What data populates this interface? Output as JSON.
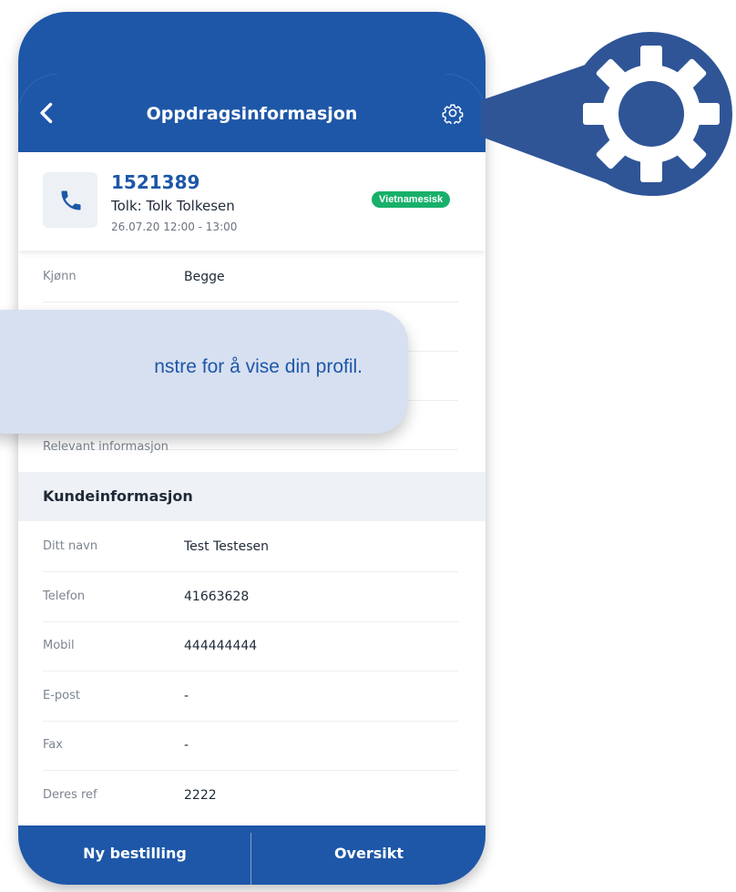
{
  "header": {
    "title": "Oppdragsinformasjon"
  },
  "job": {
    "number": "1521389",
    "interpreter": "Tolk: Tolk Tolkesen",
    "time": "26.07.20 12:00 - 13:00",
    "language": "Vietnamesisk"
  },
  "rows": [
    {
      "label": "Kjønn",
      "value": "Begge"
    },
    {
      "label": "",
      "value": ""
    },
    {
      "label": "",
      "value": ""
    },
    {
      "label": "",
      "value": ""
    },
    {
      "label": "Relevant informasjon",
      "value": ""
    }
  ],
  "customer_section": {
    "title": "Kundeinformasjon"
  },
  "customer_rows": [
    {
      "label": "Ditt navn",
      "value": "Test Testesen"
    },
    {
      "label": "Telefon",
      "value": "41663628"
    },
    {
      "label": "Mobil",
      "value": "444444444"
    },
    {
      "label": "E-post",
      "value": "-"
    },
    {
      "label": "Fax",
      "value": "-"
    },
    {
      "label": "Deres ref",
      "value": "2222"
    }
  ],
  "bottom_bar": {
    "left_label": "Ny bestilling",
    "right_label": "Oversikt"
  },
  "tooltip": {
    "text": "nstre for å vise din profil."
  },
  "colors": {
    "primary": "#1e57a8",
    "badge": "#18b06a",
    "tooltip_bg": "#d7e0f1",
    "callout": "#2f5597"
  }
}
